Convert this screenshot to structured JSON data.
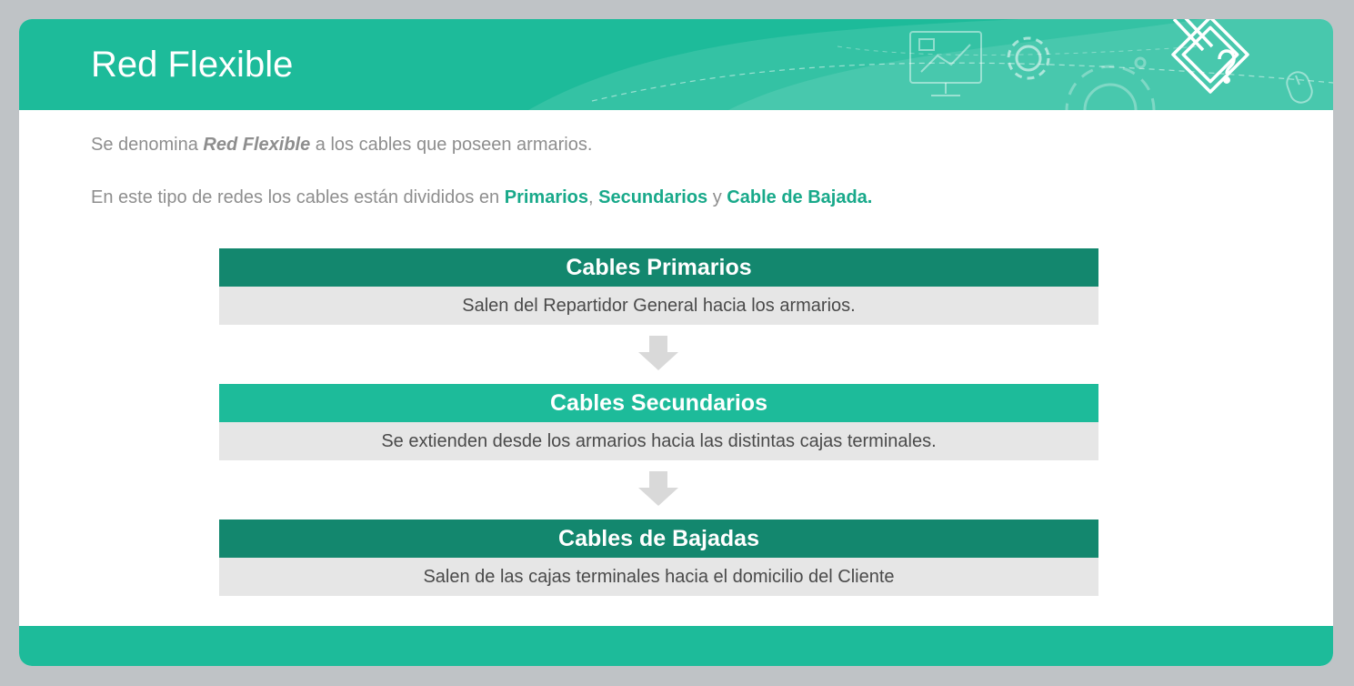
{
  "header": {
    "title": "Red Flexible",
    "icons": [
      "presentation-icon",
      "gear-icon",
      "large-gear-icon",
      "pencil-paper-icon",
      "mouse-icon"
    ]
  },
  "intro": {
    "line1_pre": "Se denomina ",
    "line1_em": "Red Flexible",
    "line1_post": " a los cables que poseen armarios.",
    "line2_pre": "En este tipo de redes los cables están divididos en ",
    "line2_hl1": "Primarios",
    "line2_sep1": ", ",
    "line2_hl2": "Secundarios",
    "line2_sep2": " y ",
    "line2_hl3": "Cable de Bajada."
  },
  "steps": [
    {
      "title": "Cables Primarios",
      "desc": "Salen del Repartidor General hacia los armarios."
    },
    {
      "title": "Cables Secundarios",
      "desc": "Se extienden desde los armarios hacia las distintas cajas terminales."
    },
    {
      "title": "Cables de Bajadas",
      "desc": "Salen de las cajas terminales hacia el domicilio del Cliente"
    }
  ],
  "colors": {
    "accent": "#1dbb9a",
    "accent_dark": "#13876e",
    "body_gray": "#e6e6e6",
    "arrow": "#d9d9d9"
  }
}
